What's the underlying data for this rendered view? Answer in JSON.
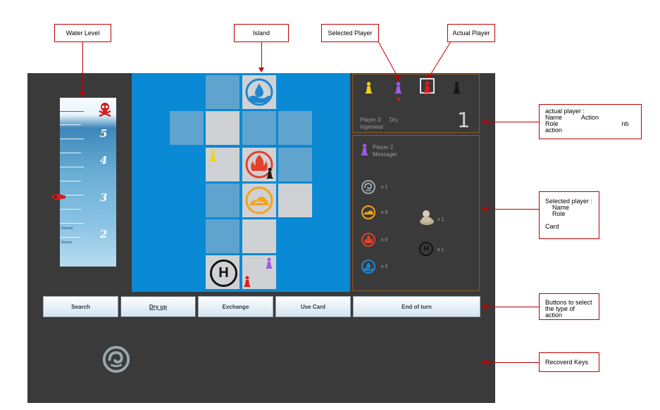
{
  "annotations": {
    "water_level": "Water Level",
    "island": "Island",
    "selected_player": "Selected Player",
    "actual_player": "Actual Player",
    "actual_player_info": [
      "actual player :",
      "Name",
      "Action",
      "Role",
      "nb action"
    ],
    "selected_player_info": [
      "Selected player :",
      "Name",
      "Role",
      "Card"
    ],
    "buttons_info": [
      "Buttons to select",
      "the type of action"
    ],
    "recovered_keys": "Recoverd Keys"
  },
  "water_meter": {
    "levels": [
      "5",
      "4",
      "3",
      "2"
    ],
    "small_labels": [
      "Normal",
      "Novice"
    ],
    "current_level": "3"
  },
  "actual_player": {
    "name": "Player 3",
    "action": "Dry",
    "role": "Ingenieur",
    "nb_action": "1"
  },
  "selected_player": {
    "name": "Player 2",
    "role": "Messager",
    "cards": [
      "x 1",
      "x 0",
      "x 0",
      "x 2"
    ],
    "specials": [
      "x 1",
      "x 1"
    ]
  },
  "heliport_letter": "H",
  "buttons": [
    "Search",
    "Dry up",
    "Exchange",
    "Use Card",
    "End of turn"
  ],
  "colors": {
    "background": "#3a3a3a",
    "sea": "#0a89d4",
    "annotation": "#c00000"
  },
  "icons": [
    "skull-icon",
    "water-icon",
    "fire-icon",
    "wind-icon",
    "earth-icon",
    "helicopter-icon",
    "statue-icon",
    "pawn-icon"
  ]
}
